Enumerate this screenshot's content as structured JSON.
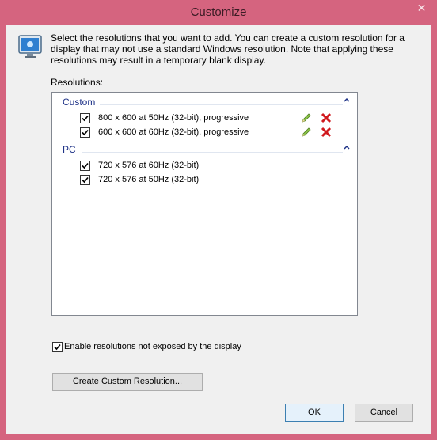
{
  "window": {
    "title": "Customize",
    "close_glyph": "✕"
  },
  "description": "Select the resolutions that you want to add. You can create a custom resolution for a display that may not use a standard Windows resolution. Note that applying these resolutions may result in a temporary blank display.",
  "resolutions_label": "Resolutions:",
  "groups": [
    {
      "title": "Custom",
      "items": [
        {
          "label": "800 x 600 at 50Hz (32-bit), progressive",
          "checked": true,
          "editable": true
        },
        {
          "label": "600 x 600 at 60Hz (32-bit), progressive",
          "checked": true,
          "editable": true
        }
      ]
    },
    {
      "title": "PC",
      "items": [
        {
          "label": "720 x 576 at 60Hz (32-bit)",
          "checked": true,
          "editable": false
        },
        {
          "label": "720 x 576 at 50Hz (32-bit)",
          "checked": true,
          "editable": false
        }
      ]
    }
  ],
  "enable_option": {
    "label": "Enable resolutions not exposed by the display",
    "checked": true
  },
  "buttons": {
    "create": "Create Custom Resolution...",
    "ok": "OK",
    "cancel": "Cancel"
  },
  "colors": {
    "titlebar": "#d5647f",
    "group_title": "#1e3287",
    "delete": "#d0191e",
    "edit": "#7cb342"
  }
}
